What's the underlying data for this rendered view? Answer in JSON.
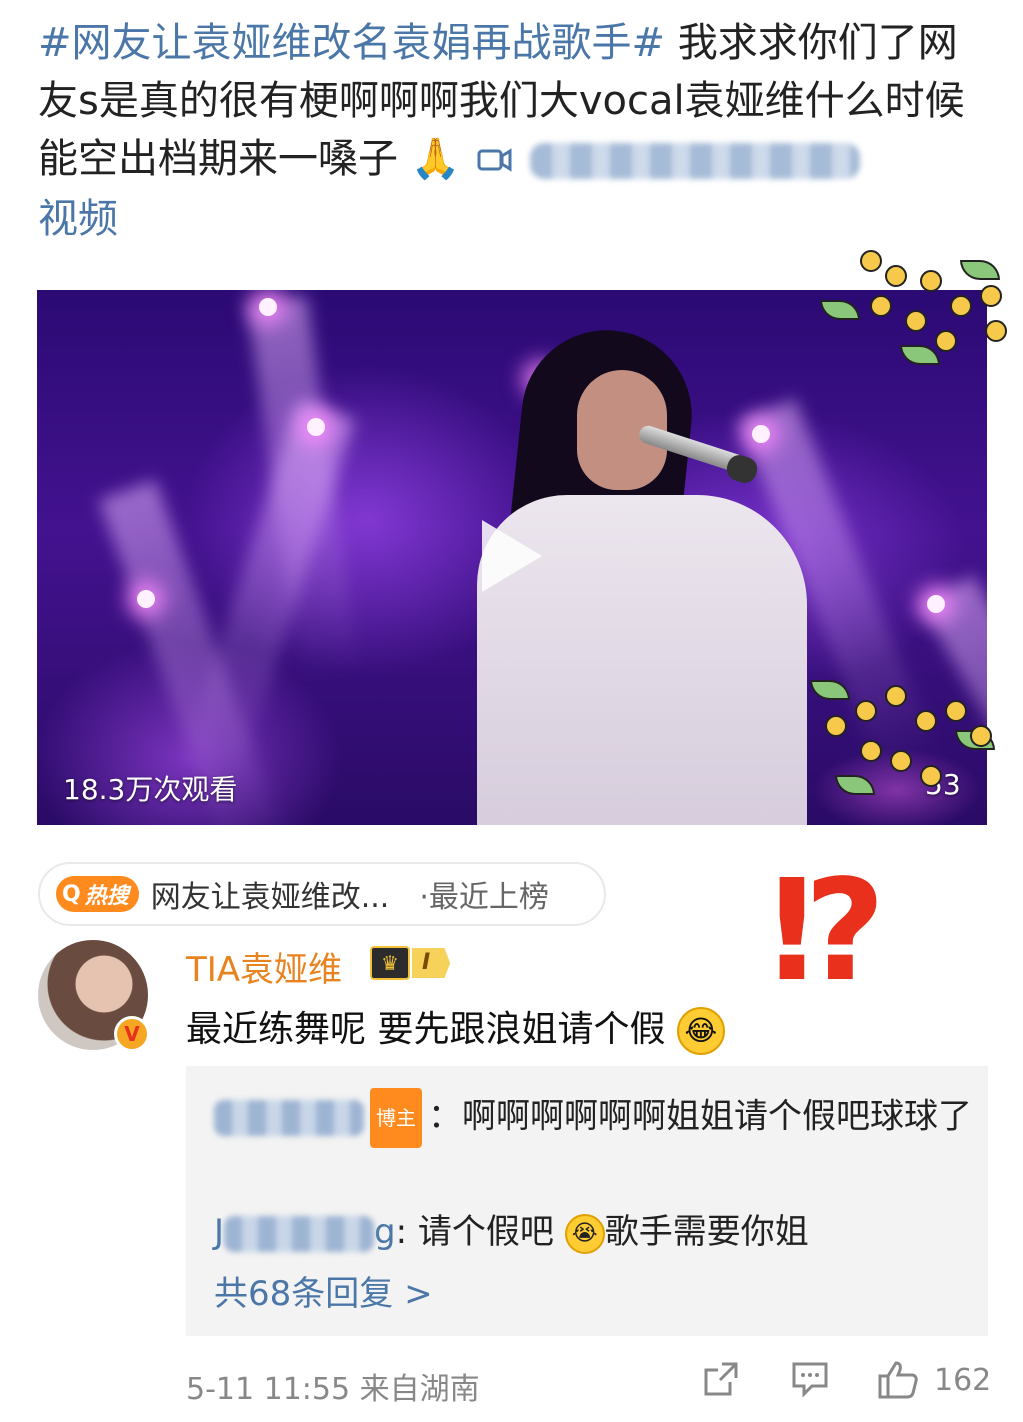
{
  "post": {
    "hashtag": "#网友让袁娅维改名袁娟再战歌手#",
    "text_part1": " 我求求你们了网友s是真的很有梗啊啊啊我们大vocal袁娅维什么时候能空出档期来一嗓子",
    "pray_emoji": "🙏",
    "video_link_label": "视频"
  },
  "video": {
    "views": "18.3万次观看",
    "duration": "53"
  },
  "hot_search": {
    "badge_label": "热搜",
    "title": "网友让袁娅维改...",
    "status": "·最近上榜"
  },
  "sticker": {
    "symbol": "⁉"
  },
  "comment": {
    "username": "TIA袁娅维",
    "level": "I",
    "text": "最近练舞呢 要先跟浪姐请个假",
    "emoji": "😂",
    "verified_label": "V"
  },
  "replies": {
    "reply1": {
      "badge": "博主",
      "text": "：啊啊啊啊啊啊姐姐请个假吧球球了"
    },
    "reply2": {
      "name_prefix": "J",
      "name_suffix": "g",
      "text_before": ": 请个假吧",
      "text_after": "歌手需要你姐"
    },
    "more": "共68条回复 >"
  },
  "footer": {
    "time": "5-11 11:55",
    "location": "来自湖南",
    "like_count": "162"
  },
  "colors": {
    "link": "#4b77a8",
    "username": "#e88420",
    "hot_badge": "#ff8a1e",
    "alert": "#e8301c"
  }
}
